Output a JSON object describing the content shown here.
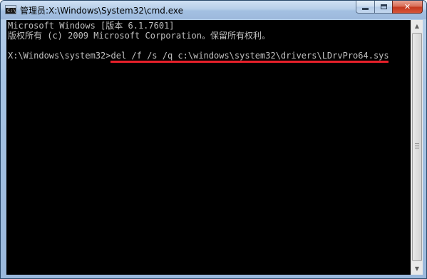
{
  "window": {
    "title": "管理员:X:\\Windows\\System32\\cmd.exe",
    "icon": "cmd-icon",
    "icon_text": "C:\\_"
  },
  "caption_buttons": {
    "minimize": "minimize-icon",
    "maximize": "maximize-icon",
    "close": "✕"
  },
  "console": {
    "lines": [
      "Microsoft Windows [版本 6.1.7601]",
      "版权所有 (c) 2009 Microsoft Corporation。保留所有权利。",
      "",
      "X:\\Windows\\system32>del /f /s /q c:\\windows\\system32\\drivers\\LDrvPro64.sys"
    ],
    "prompt": "X:\\Windows\\system32>",
    "command": "del /f /s /q c:\\windows\\system32\\drivers\\LDrvPro64.sys",
    "highlight_color": "#e8202a"
  },
  "scrollbar": {
    "up": "▲",
    "down": "▼"
  }
}
